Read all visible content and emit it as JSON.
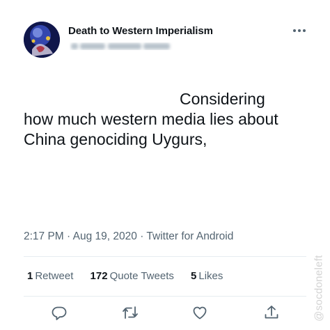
{
  "author": {
    "display_name": "Death to Western Imperialism",
    "avatar_icon": "profile-avatar"
  },
  "tweet": {
    "line1": "Considering",
    "line2": "how much western media lies about",
    "line3": "China genociding Uygurs,"
  },
  "meta": {
    "time": "2:17 PM",
    "separator": "·",
    "date": "Aug 19, 2020",
    "source": "Twitter for Android"
  },
  "stats": {
    "retweets_count": "1",
    "retweets_label": "Retweet",
    "quotes_count": "172",
    "quotes_label": "Quote Tweets",
    "likes_count": "5",
    "likes_label": "Likes"
  },
  "icons": {
    "more": "more-horizontal-icon",
    "reply": "reply-icon",
    "retweet": "retweet-icon",
    "like": "heart-icon",
    "share": "share-icon"
  },
  "colors": {
    "text": "#0f1419",
    "secondary": "#536471",
    "divider": "#e6ecf0"
  },
  "watermark": "@socdoneleft"
}
